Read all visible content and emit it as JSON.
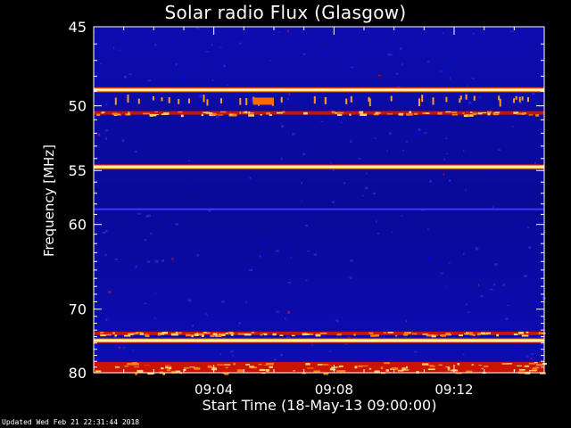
{
  "updated_text": "Updated Wed Feb 21 22:31:44 2018",
  "chart_data": {
    "type": "heatmap",
    "title": "Solar radio Flux (Glasgow)",
    "xlabel": "Start Time (18-May-13 09:00:00)",
    "ylabel": "Frequency [MHz]",
    "x_ticks": [
      "09:04",
      "09:08",
      "09:12"
    ],
    "x_tick_minutes": [
      4,
      8,
      12
    ],
    "x_range_minutes": [
      0,
      15
    ],
    "y_ticks": [
      45,
      50,
      55,
      60,
      70,
      80
    ],
    "y_range_mhz": [
      45,
      80
    ],
    "y_scale": "reciprocal",
    "colormap": "blue-red-yellow-white",
    "colors": {
      "background": "#000000",
      "low": "#0a0aa8",
      "mid": "#d82000",
      "high": "#ffff80"
    },
    "bands": [
      {
        "freq_mhz": 48.9,
        "intensity": 1.0
      },
      {
        "freq_mhz": 50.5,
        "intensity": 0.75
      },
      {
        "freq_mhz": 54.7,
        "intensity": 1.0
      },
      {
        "freq_mhz": 58.5,
        "intensity": 0.2
      },
      {
        "freq_mhz": 73.5,
        "intensity": 0.6
      },
      {
        "freq_mhz": 74.6,
        "intensity": 1.0
      },
      {
        "freq_mhz": 78.8,
        "intensity": 0.7
      },
      {
        "freq_mhz": 79.4,
        "intensity": 0.8
      }
    ]
  }
}
